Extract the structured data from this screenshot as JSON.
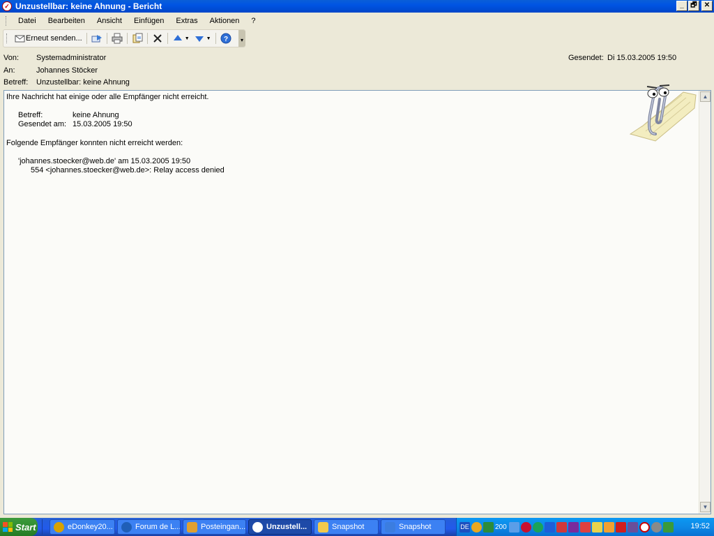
{
  "window": {
    "title": "Unzustellbar: keine Ahnung - Bericht",
    "buttons": [
      "_",
      "🗗",
      "✕"
    ]
  },
  "menu": [
    "Datei",
    "Bearbeiten",
    "Ansicht",
    "Einfügen",
    "Extras",
    "Aktionen",
    "?"
  ],
  "toolbar": {
    "resend_label": "Erneut senden...",
    "icons": [
      "resend-icon",
      "forward-icon",
      "print-icon",
      "move-icon",
      "delete-icon",
      "previous-icon",
      "next-icon",
      "help-icon"
    ]
  },
  "header": {
    "from_label": "Von:",
    "from_value": "Systemadministrator",
    "to_label": "An:",
    "to_value": "Johannes Stöcker",
    "subject_label": "Betreff:",
    "subject_value": "Unzustellbar: keine Ahnung",
    "sent_label": "Gesendet:",
    "sent_value": "Di 15.03.2005 19:50"
  },
  "body": {
    "line1": "Ihre Nachricht hat einige oder alle Empfänger nicht erreicht.",
    "subject_label": "Betreff:",
    "subject_value": "keine Ahnung",
    "sent_label": "Gesendet am:",
    "sent_value": "15.03.2005 19:50",
    "line2": "Folgende Empfänger konnten nicht erreicht werden:",
    "recipient": "'johannes.stoecker@web.de' am 15.03.2005 19:50",
    "error": "554 <johannes.stoecker@web.de>: Relay access denied"
  },
  "taskbar": {
    "start_label": "Start",
    "tasks": [
      {
        "label": "eDonkey20...",
        "icon_color": "#d9a200"
      },
      {
        "label": "Forum de L...",
        "icon_color": "#1f5fb8"
      },
      {
        "label": "Posteingan...",
        "icon_color": "#e0a030"
      },
      {
        "label": "Unzustell...",
        "icon_color": "#ffffff"
      },
      {
        "label": "Snapshot",
        "icon_color": "#f2c94c"
      },
      {
        "label": "Snapshot",
        "icon_color": "#3b7de0"
      }
    ],
    "tray_text": "200",
    "tray_lang": "DE",
    "clock": "19:52"
  },
  "colors": {
    "titlebar": "#0054e3",
    "taskbar": "#245edc",
    "start": "#2f8b2f"
  }
}
